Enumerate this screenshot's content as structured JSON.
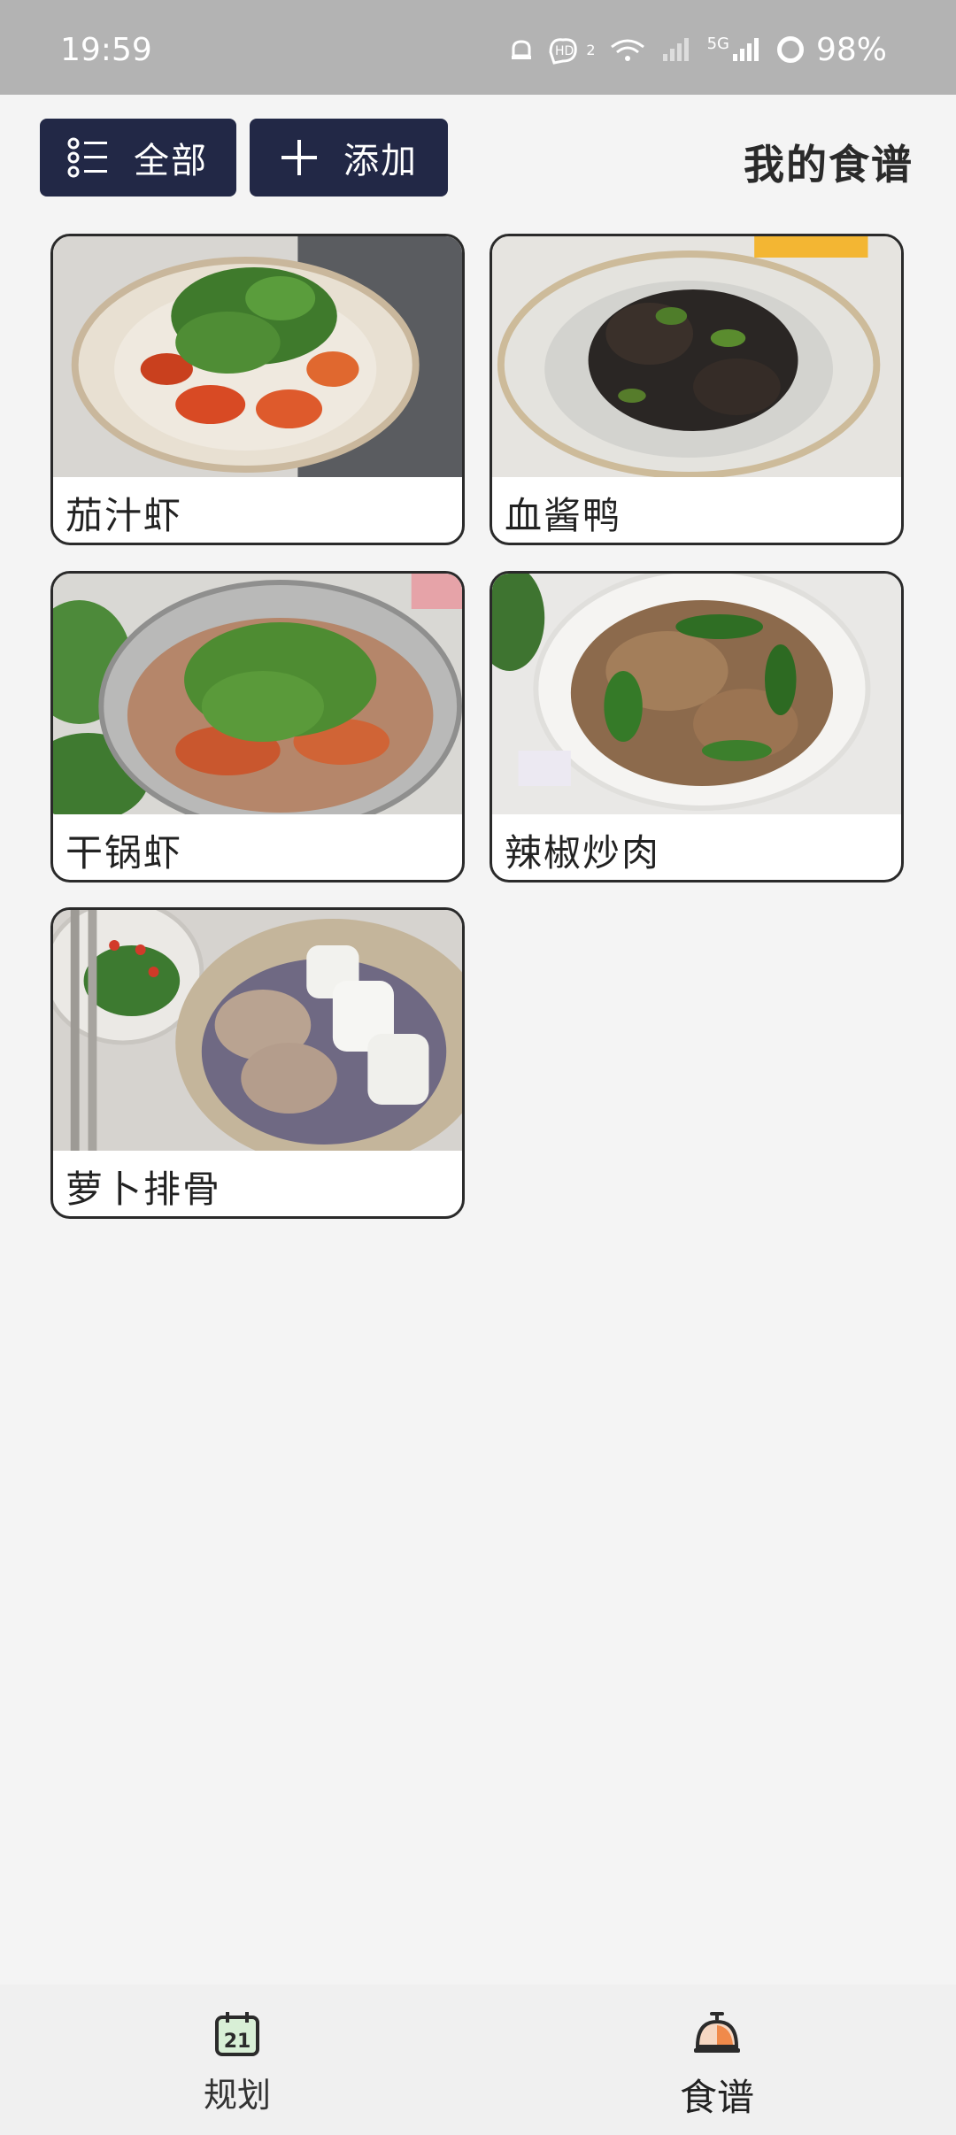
{
  "status_bar": {
    "time": "19:59",
    "icons": [
      "notification-icon",
      "hd-voice-icon",
      "wifi-icon",
      "signal-icon",
      "5g-signal-icon"
    ],
    "hd_sub": "2",
    "network": "5G",
    "battery": "98%"
  },
  "header": {
    "all_button": "全部",
    "add_button": "添加",
    "title": "我的食谱"
  },
  "recipes": [
    {
      "name": "茄汁虾"
    },
    {
      "name": "血酱鸭"
    },
    {
      "name": "干锅虾"
    },
    {
      "name": "辣椒炒肉"
    },
    {
      "name": "萝卜排骨"
    }
  ],
  "bottom_nav": {
    "plan_label": "规划",
    "plan_icon_text": "21",
    "recipes_label": "食谱"
  }
}
